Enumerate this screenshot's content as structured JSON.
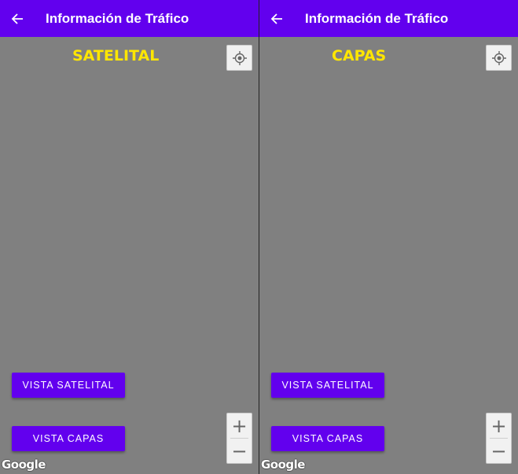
{
  "app": {
    "title": "Información de Tráfico"
  },
  "panels": [
    {
      "overlay_label": "SATELITAL"
    },
    {
      "overlay_label": "CAPAS"
    }
  ],
  "buttons": {
    "vista_satelital": "VISTA SATELITAL",
    "vista_capas": "VISTA CAPAS"
  },
  "map": {
    "zoom_in": "+",
    "zoom_out": "−",
    "attribution": "Google"
  },
  "icons": {
    "back": "back-arrow-icon",
    "locate": "my-location-icon"
  },
  "colors": {
    "appbar": "#6200ee",
    "button": "#6200ee",
    "overlay_label": "#ffe600",
    "map_background": "#808080"
  }
}
